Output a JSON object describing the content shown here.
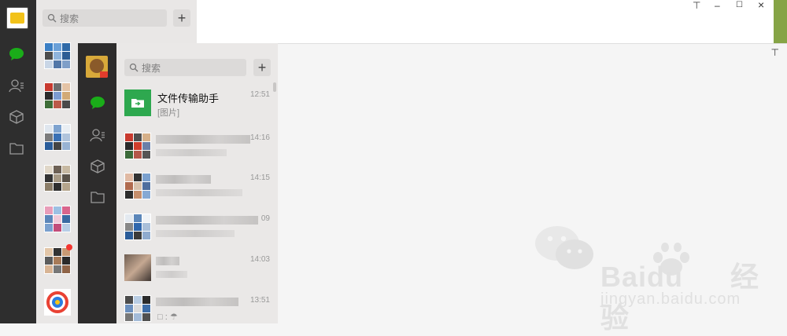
{
  "back_window": {
    "search_placeholder": "搜索",
    "add_label": "+",
    "controls": {
      "pin": "⊤",
      "minimize": "–",
      "maximize": "☐",
      "close": "×"
    }
  },
  "front_window": {
    "search_placeholder": "搜索",
    "add_label": "+",
    "pin": "⊤",
    "chats": [
      {
        "name": "文件传输助手",
        "message": "[图片]",
        "time": "12:51"
      },
      {
        "name": "",
        "message": "",
        "time": "14:16"
      },
      {
        "name": "",
        "message": "",
        "time": "14:15"
      },
      {
        "name": "",
        "message": "",
        "time": "09"
      },
      {
        "name": "",
        "message": "",
        "time": "14:03"
      },
      {
        "name": "",
        "message": "□ : ☂",
        "time": "13:51"
      }
    ]
  },
  "watermark": {
    "brand": "Baidu",
    "brand_cn": "经验",
    "url": "jingyan.baidu.com"
  },
  "colors": {
    "wechat_green": "#1aad19",
    "file_helper_green": "#2ea84f",
    "unread_red": "#f43530"
  }
}
